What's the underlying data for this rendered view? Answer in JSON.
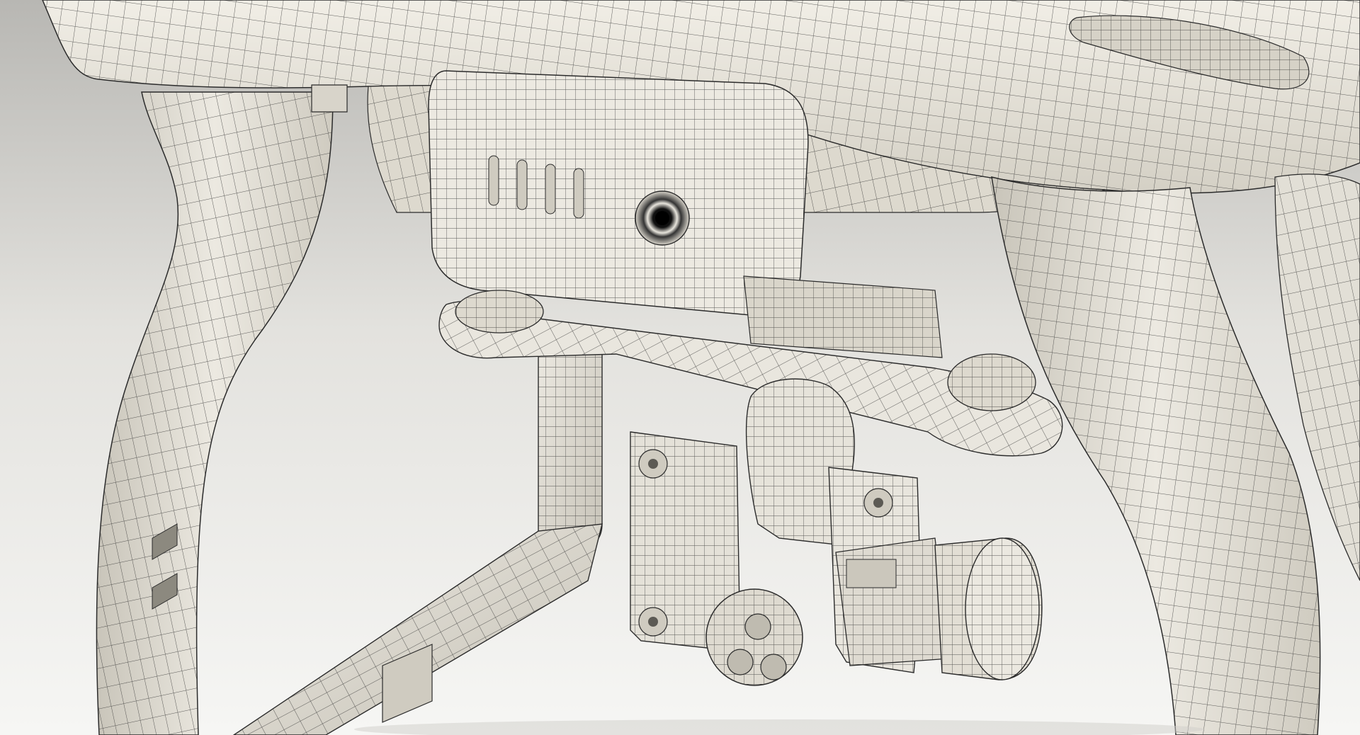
{
  "scene": {
    "subject": "drone-underside-wireframe-render",
    "colors": {
      "background_top": "#bdbcb8",
      "background_bottom": "#f4f4f2",
      "surface": "#e9e6dd",
      "surface_shadow": "#c9c5ba",
      "surface_dark": "#a9a59b",
      "wire": "#2b2b2b",
      "lens_dark": "#111111"
    },
    "objects": [
      "drone-body",
      "landing-leg-left",
      "landing-leg-right",
      "landing-skid",
      "battery-pod",
      "gimbal-mount-plate",
      "gimbal-arm",
      "gimbal-motor",
      "camera-housing",
      "camera-lens"
    ]
  }
}
